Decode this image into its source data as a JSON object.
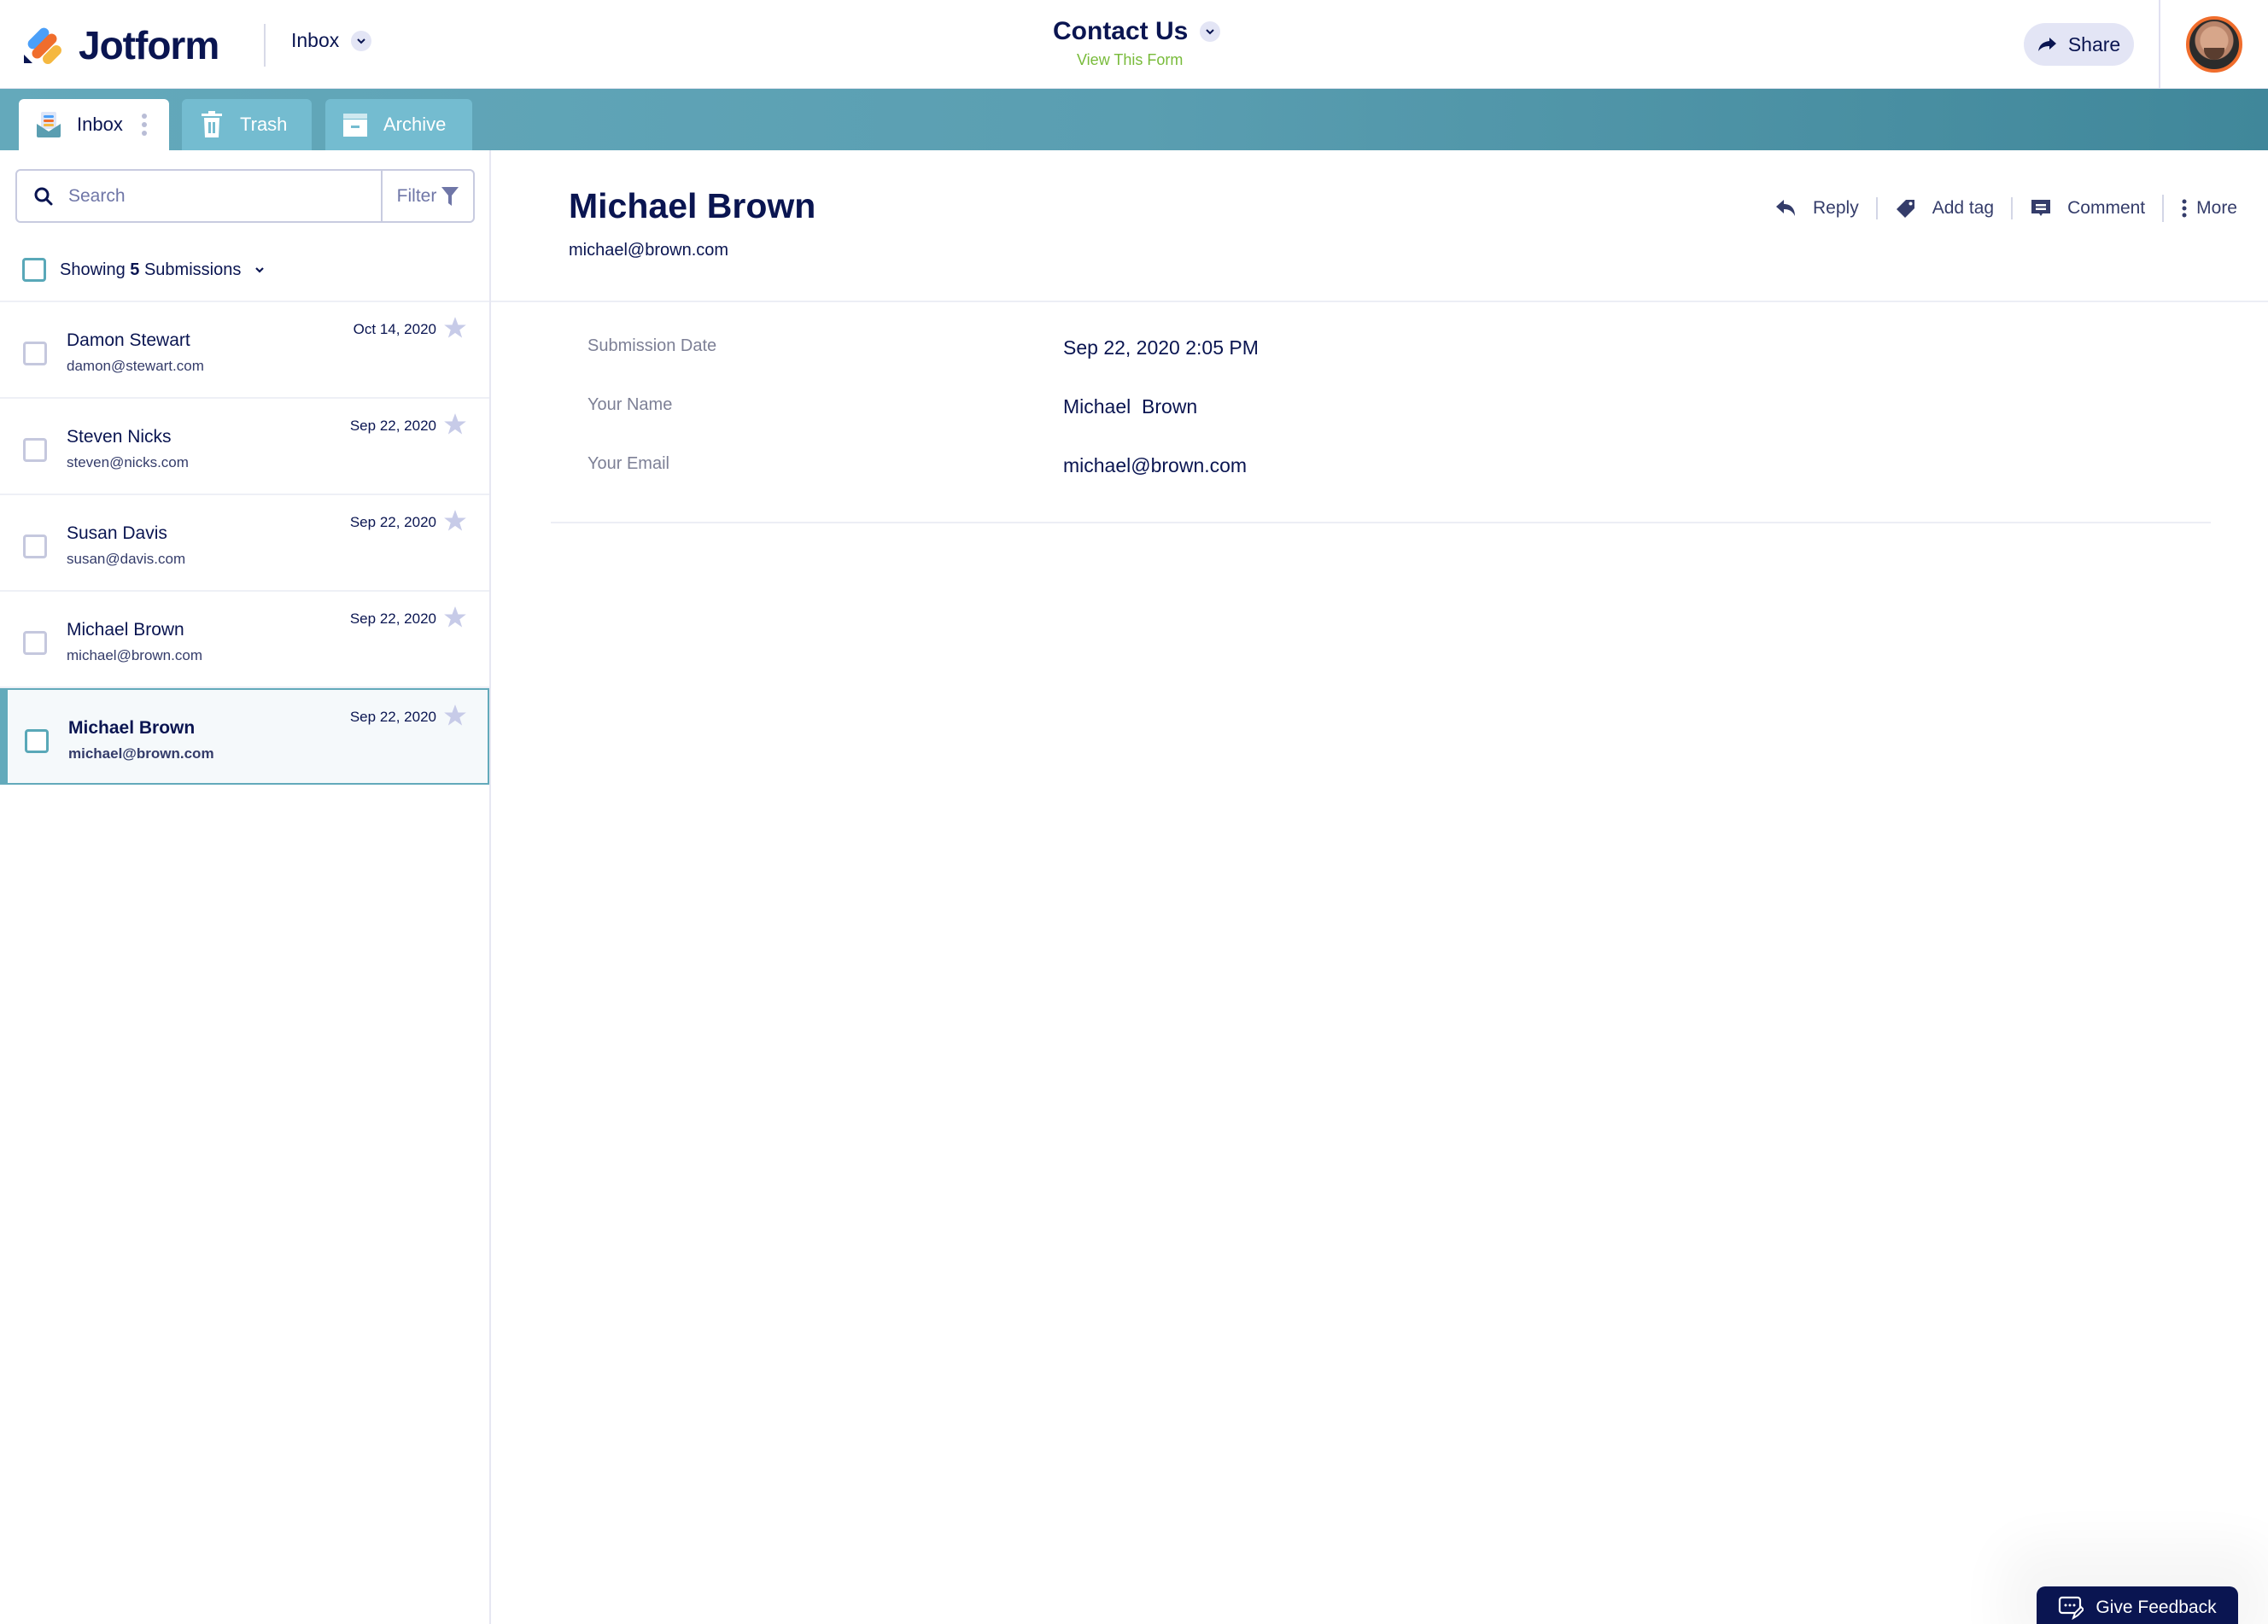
{
  "header": {
    "brand": "Jotform",
    "section_switch": "Inbox",
    "form_title": "Contact Us",
    "view_form_link": "View This Form",
    "share_label": "Share",
    "avatar_alt": "User avatar"
  },
  "tabs": [
    {
      "label": "Inbox",
      "icon": "inbox-icon",
      "active": true
    },
    {
      "label": "Trash",
      "icon": "trash-icon",
      "active": false
    },
    {
      "label": "Archive",
      "icon": "archive-icon",
      "active": false
    }
  ],
  "sidebar": {
    "search_placeholder": "Search",
    "search_value": "",
    "filter_label": "Filter",
    "showing_prefix": "Showing",
    "showing_count": "5",
    "showing_suffix": "Submissions",
    "submissions": [
      {
        "name": "Damon Stewart",
        "email": "damon@stewart.com",
        "date": "Oct 14, 2020",
        "starred": false,
        "selected": false
      },
      {
        "name": "Steven Nicks",
        "email": "steven@nicks.com",
        "date": "Sep 22, 2020",
        "starred": false,
        "selected": false
      },
      {
        "name": "Susan Davis",
        "email": "susan@davis.com",
        "date": "Sep 22, 2020",
        "starred": false,
        "selected": false
      },
      {
        "name": "Michael Brown",
        "email": "michael@brown.com",
        "date": "Sep 22, 2020",
        "starred": false,
        "selected": false
      },
      {
        "name": "Michael Brown",
        "email": "michael@brown.com",
        "date": "Sep 22, 2020",
        "starred": false,
        "selected": true
      }
    ]
  },
  "detail": {
    "name": "Michael Brown",
    "email": "michael@brown.com",
    "actions": {
      "reply": "Reply",
      "add_tag": "Add tag",
      "comment": "Comment",
      "more": "More"
    },
    "fields": [
      {
        "label": "Submission Date",
        "value": "Sep 22, 2020 2:05 PM"
      },
      {
        "label": "Your Name",
        "value": "Michael  Brown"
      },
      {
        "label": "Your Email",
        "value": "michael@brown.com"
      }
    ]
  },
  "feedback": {
    "label": "Give Feedback"
  },
  "colors": {
    "brand_navy": "#0a1551",
    "teal_bar": "#5a9eb1",
    "teal_tab": "#74bcd0",
    "selected_accent": "#63aabb",
    "link_green": "#78bb3a",
    "avatar_ring": "#f06d2c",
    "star": "#c7cbe8"
  }
}
